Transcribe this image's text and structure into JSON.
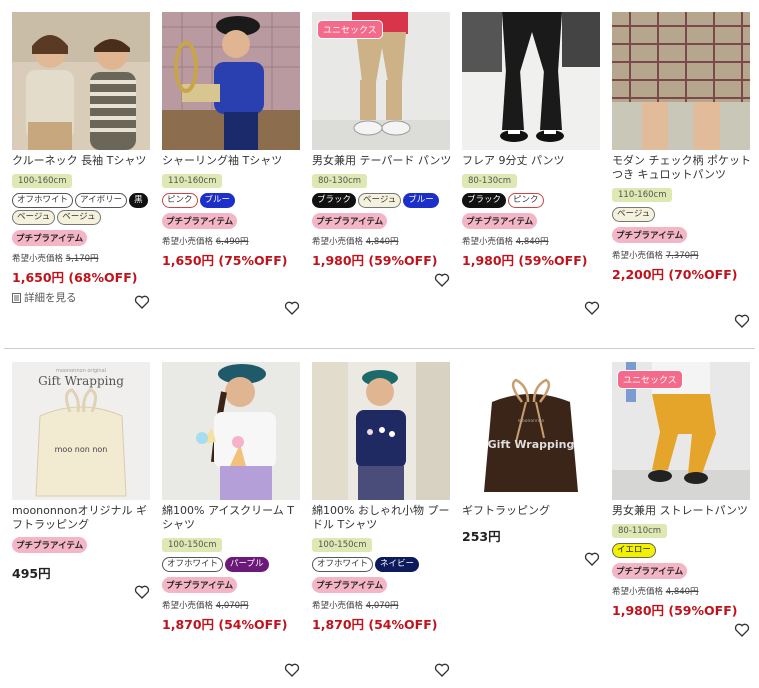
{
  "common": {
    "unisex_label": "ユニセックス",
    "petit_label": "プチプラアイテム",
    "rrp_label": "希望小売価格"
  },
  "products": [
    {
      "name": "クルーネック 長袖 Tシャツ",
      "size": "100-160cm",
      "colors": [
        "オフホワイト",
        "アイボリー",
        "黒",
        "ベージュ",
        "ベージュ"
      ],
      "petit": true,
      "rrp": "5,170円",
      "price": "1,650円 (68%OFF)",
      "detail": "詳細を見る"
    },
    {
      "name": "シャーリング袖 Tシャツ",
      "size": "110-160cm",
      "colors": [
        "ピンク",
        "ブルー"
      ],
      "petit": true,
      "rrp": "6,490円",
      "price": "1,650円 (75%OFF)"
    },
    {
      "name": "男女兼用 テーパード パンツ",
      "size": "80-130cm",
      "colors": [
        "ブラック",
        "ベージュ",
        "ブルー"
      ],
      "petit": true,
      "rrp": "4,840円",
      "price": "1,980円 (59%OFF)",
      "unisex": true
    },
    {
      "name": "フレア 9分丈 パンツ",
      "size": "80-130cm",
      "colors": [
        "ブラック",
        "ピンク"
      ],
      "petit": true,
      "rrp": "4,840円",
      "price": "1,980円 (59%OFF)"
    },
    {
      "name": "モダン チェック柄 ポケットつき キュロットパンツ",
      "size": "110-160cm",
      "colors": [
        "ベージュ"
      ],
      "petit": true,
      "rrp": "7,370円",
      "price": "2,200円 (70%OFF)"
    },
    {
      "name": "moononnonオリジナル ギフトラッピング",
      "petit": true,
      "price": "495円"
    },
    {
      "name": "綿100% アイスクリーム Tシャツ",
      "size": "100-150cm",
      "colors": [
        "オフホワイト",
        "パープル"
      ],
      "petit": true,
      "rrp": "4,070円",
      "price": "1,870円 (54%OFF)"
    },
    {
      "name": "綿100% おしゃれ小物 プードル Tシャツ",
      "size": "100-150cm",
      "colors": [
        "オフホワイト",
        "ネイビー"
      ],
      "petit": true,
      "rrp": "4,070円",
      "price": "1,870円 (54%OFF)"
    },
    {
      "name": "ギフトラッピング",
      "price": "253円"
    },
    {
      "name": "男女兼用 ストレートパンツ",
      "size": "80-110cm",
      "colors": [
        "イエロー"
      ],
      "petit": true,
      "rrp": "4,840円",
      "price": "1,980円 (59%OFF)",
      "unisex": true
    }
  ],
  "images": {
    "gift_wrap_1_brand": "moononnon original",
    "gift_wrap_1_title": "Gift Wrapping",
    "gift_wrap_1_bag": "moo non non",
    "gift_wrap_2_brand": "moononnon",
    "gift_wrap_2_title": "Gift Wrapping"
  }
}
